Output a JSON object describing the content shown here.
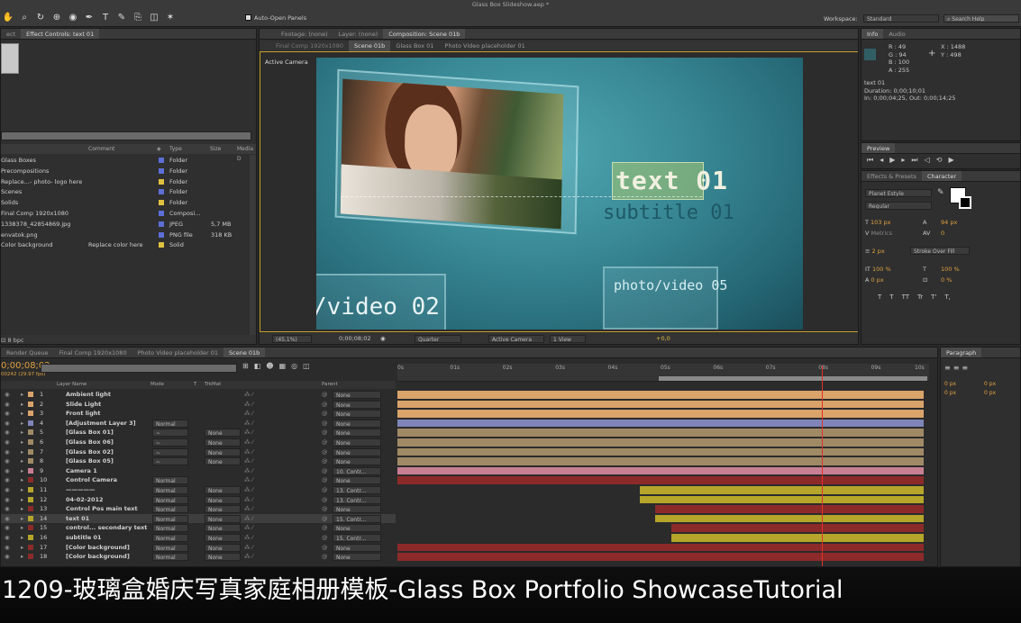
{
  "window_title": "Glass Box Slideshow.aep *",
  "toolbar": {
    "auto_open": "Auto-Open Panels",
    "workspace_label": "Workspace:",
    "workspace_value": "Standard",
    "search_help": "Search Help"
  },
  "project_panel": {
    "tabs": [
      "ect",
      "Effect Controls: text 01"
    ],
    "columns": [
      "",
      "Comment",
      "Type",
      "Size",
      "Media D"
    ],
    "items": [
      {
        "name": "Glass Boxes",
        "comment": "",
        "type": "Folder",
        "size": "",
        "color": "#5b6fd6"
      },
      {
        "name": "Precompositions",
        "comment": "",
        "type": "Folder",
        "size": "",
        "color": "#5b6fd6"
      },
      {
        "name": "Replace...- photo- logo here",
        "comment": "",
        "type": "Folder",
        "size": "",
        "color": "#e0c040"
      },
      {
        "name": "Scenes",
        "comment": "",
        "type": "Folder",
        "size": "",
        "color": "#5b6fd6"
      },
      {
        "name": "Solids",
        "comment": "",
        "type": "Folder",
        "size": "",
        "color": "#e0c040"
      },
      {
        "name": "Final Comp 1920x1080",
        "comment": "",
        "type": "Composi...",
        "size": "",
        "color": "#5b6fd6"
      },
      {
        "name": "1338378_42854869.jpg",
        "comment": "",
        "type": "JPEG",
        "size": "5,7 MB",
        "color": "#5b6fd6"
      },
      {
        "name": "envatok.png",
        "comment": "",
        "type": "PNG file",
        "size": "318 KB",
        "color": "#5b6fd6"
      },
      {
        "name": "Color background",
        "comment": "Replace color here",
        "type": "Solid",
        "size": "",
        "color": "#e0c040"
      }
    ],
    "bpc": "8 bpc"
  },
  "composition": {
    "tabs": [
      "Footage: (none)",
      "Layer: (none)",
      "Composition: Scene 01b"
    ],
    "breadcrumbs": [
      "Final Comp 1920x1080",
      "Scene 01b",
      "Glass Box 01",
      "Photo Video placeholder 01"
    ],
    "active_camera": "Active Camera",
    "overlay_text": "text 01",
    "overlay_subtitle": "subtitle 01",
    "overlay_video02": "/video 02",
    "overlay_video05": "photo/video 05",
    "footer": {
      "zoom": "(45,1%)",
      "timecode": "0;00;08;02",
      "resolution": "Quarter",
      "view": "Active Camera",
      "views": "1 View",
      "exposure": "+0,0"
    }
  },
  "info_panel": {
    "tabs": [
      "Info",
      "Audio"
    ],
    "r": "R : 49",
    "g": "G : 94",
    "b": "B : 100",
    "a": "A : 255",
    "x": "X : 1488",
    "y": "Y : 498",
    "layer_name": "text 01",
    "duration": "Duration: 0;00;10;01",
    "in_out": "In: 0;00;04;25, Out: 0;00;14;25"
  },
  "preview_panel": {
    "tab": "Preview"
  },
  "character_panel": {
    "tabs": [
      "Effects & Presets",
      "Character"
    ],
    "font": "Planet Estyle",
    "style": "Regular",
    "size": "103 px",
    "leading": "94 px",
    "kerning": "Metrics",
    "tracking": "0",
    "stroke": "2 px",
    "stroke_type": "Stroke Over Fill",
    "v_scale": "100 %",
    "h_scale": "100 %",
    "baseline": "0 px",
    "tsume": "0 %",
    "styles": [
      "T",
      "T",
      "TT",
      "Tr",
      "T'",
      "T,"
    ]
  },
  "paragraph_panel": {
    "tab": "Paragraph",
    "v1": "0 px",
    "v2": "0 px",
    "v3": "0 px",
    "v4": "0 px"
  },
  "timeline": {
    "tabs": [
      "Render Queue",
      "Final Comp 1920x1080",
      "Photo Video placeholder 01",
      "Scene 01b"
    ],
    "timecode": "0;00;08;02",
    "fps": "00242 (29.97 fps)",
    "col_layer_name": "Layer Name",
    "col_mode": "Mode",
    "col_t": "T",
    "col_trkmat": "TrkMat",
    "col_parent": "Parent",
    "ruler": [
      "0s",
      "01s",
      "02s",
      "03s",
      "04s",
      "05s",
      "06s",
      "07s",
      "08s",
      "09s",
      "10s"
    ],
    "layers": [
      {
        "num": "1",
        "name": "Ambient light",
        "mode": "",
        "trkmat": "",
        "parent": "None",
        "color": "#d9a36a",
        "bar_start": 0,
        "bar_end": 10
      },
      {
        "num": "2",
        "name": "Slide Light",
        "mode": "",
        "trkmat": "",
        "parent": "None",
        "color": "#d9a36a",
        "bar_start": 0,
        "bar_end": 10
      },
      {
        "num": "3",
        "name": "Front light",
        "mode": "",
        "trkmat": "",
        "parent": "None",
        "color": "#d9a36a",
        "bar_start": 0,
        "bar_end": 10
      },
      {
        "num": "4",
        "name": "[Adjustment Layer 3]",
        "mode": "Normal",
        "trkmat": "",
        "parent": "None",
        "color": "#7f85b8",
        "bar_start": 0,
        "bar_end": 10
      },
      {
        "num": "5",
        "name": "[Glass Box 01]",
        "mode": "~",
        "trkmat": "None",
        "parent": "None",
        "color": "#a08a66",
        "bar_start": 0,
        "bar_end": 10
      },
      {
        "num": "6",
        "name": "[Glass Box 06]",
        "mode": "~",
        "trkmat": "None",
        "parent": "None",
        "color": "#a08a66",
        "bar_start": 0,
        "bar_end": 10
      },
      {
        "num": "7",
        "name": "[Glass Box 02]",
        "mode": "~",
        "trkmat": "None",
        "parent": "None",
        "color": "#a08a66",
        "bar_start": 0,
        "bar_end": 10
      },
      {
        "num": "8",
        "name": "[Glass Box 05]",
        "mode": "~",
        "trkmat": "None",
        "parent": "None",
        "color": "#a08a66",
        "bar_start": 0,
        "bar_end": 10
      },
      {
        "num": "9",
        "name": "Camera 1",
        "mode": "",
        "trkmat": "",
        "parent": "10. Contr...",
        "color": "#c87f93",
        "bar_start": 0,
        "bar_end": 10
      },
      {
        "num": "10",
        "name": "Control Camera",
        "mode": "Normal",
        "trkmat": "",
        "parent": "None",
        "color": "#8c2a2a",
        "bar_start": 0,
        "bar_end": 10
      },
      {
        "num": "11",
        "name": "—————",
        "mode": "Normal",
        "trkmat": "None",
        "parent": "13. Contr...",
        "color": "#b5a52a",
        "bar_start": 4.6,
        "bar_end": 10
      },
      {
        "num": "12",
        "name": "04-02-2012",
        "mode": "Normal",
        "trkmat": "None",
        "parent": "13. Contr...",
        "color": "#b5a52a",
        "bar_start": 4.6,
        "bar_end": 10
      },
      {
        "num": "13",
        "name": "Control Pos main text",
        "mode": "Normal",
        "trkmat": "None",
        "parent": "None",
        "color": "#8c2a2a",
        "bar_start": 4.9,
        "bar_end": 10
      },
      {
        "num": "14",
        "name": "text 01",
        "mode": "Normal",
        "trkmat": "None",
        "parent": "15. Contr...",
        "color": "#b5a52a",
        "bar_start": 4.9,
        "bar_end": 10
      },
      {
        "num": "15",
        "name": "control... secondary text",
        "mode": "Normal",
        "trkmat": "None",
        "parent": "None",
        "color": "#8c2a2a",
        "bar_start": 5.2,
        "bar_end": 10
      },
      {
        "num": "16",
        "name": "subtitle 01",
        "mode": "Normal",
        "trkmat": "None",
        "parent": "15. Contr...",
        "color": "#b5a52a",
        "bar_start": 5.2,
        "bar_end": 10
      },
      {
        "num": "17",
        "name": "[Color background]",
        "mode": "Normal",
        "trkmat": "None",
        "parent": "None",
        "color": "#8c2a2a",
        "bar_start": 0,
        "bar_end": 10
      },
      {
        "num": "18",
        "name": "[Color background]",
        "mode": "Normal",
        "trkmat": "None",
        "parent": "None",
        "color": "#8c2a2a",
        "bar_start": 0,
        "bar_end": 10
      }
    ],
    "playhead_seconds": 8.06
  },
  "caption": "1209-玻璃盒婚庆写真家庭相册模板-Glass Box Portfolio ShowcaseTutorial"
}
